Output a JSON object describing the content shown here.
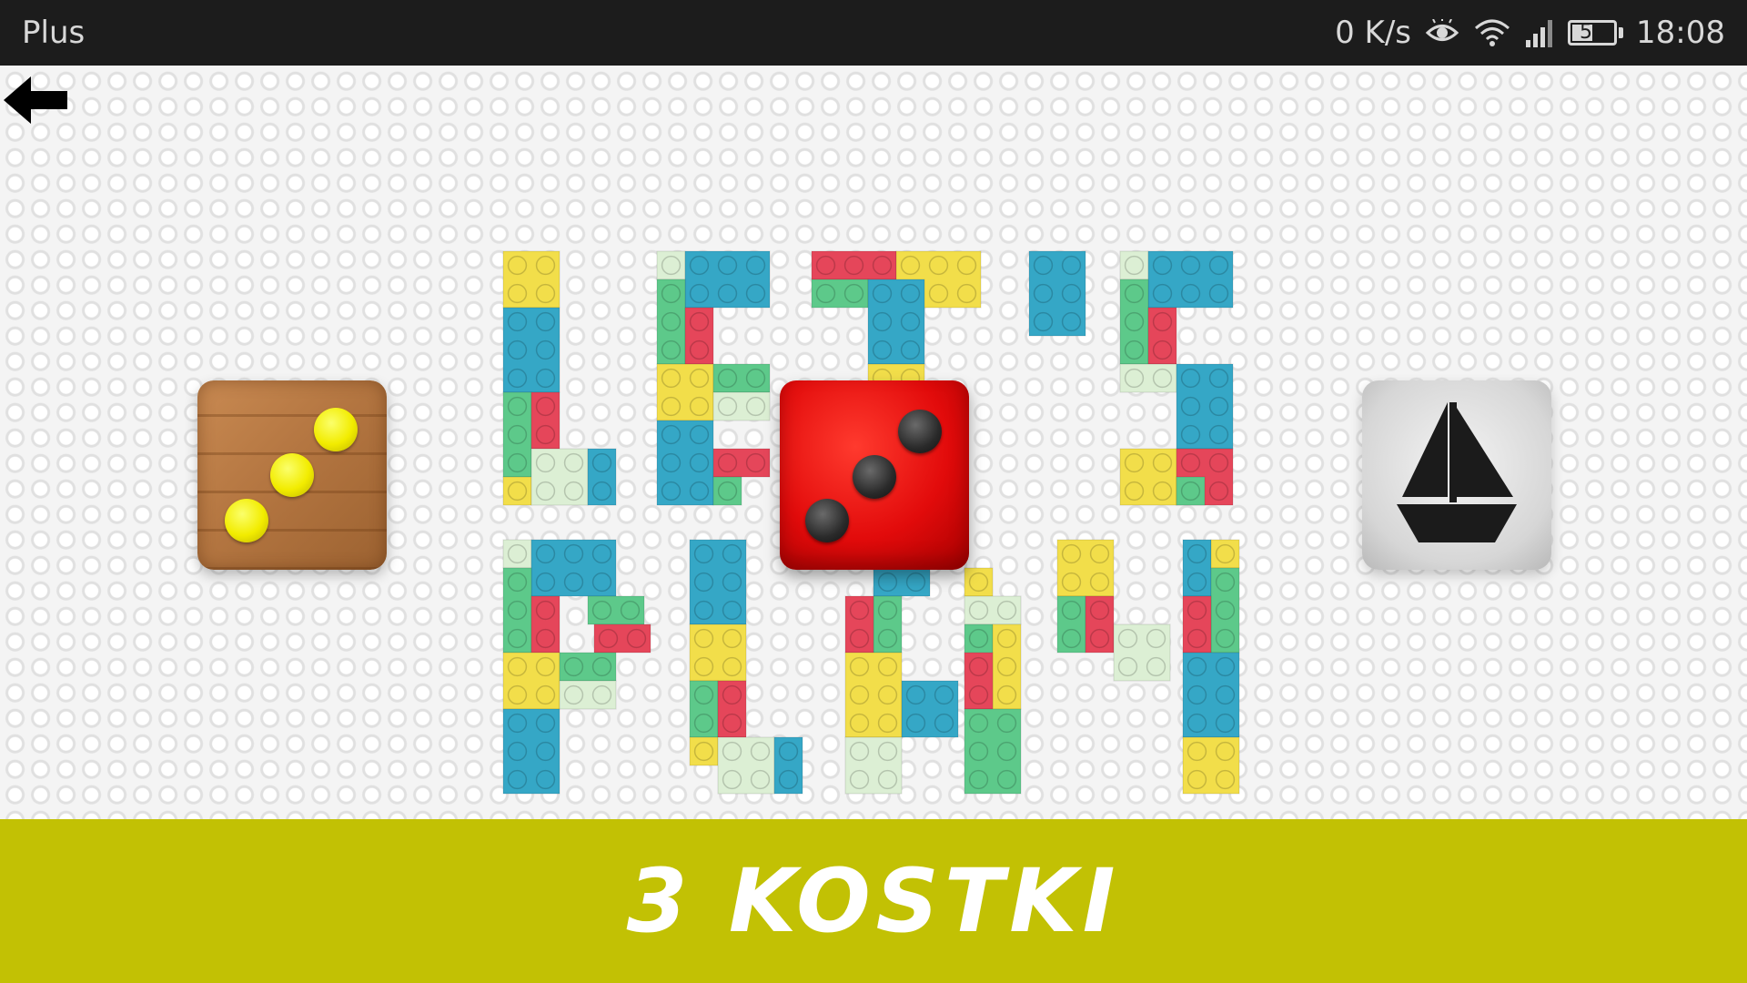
{
  "status_bar": {
    "carrier": "Plus",
    "network_speed": "0 K/s",
    "battery_level": 51,
    "battery_text": "51",
    "time": "18:08",
    "icons": [
      "eye-icon",
      "wifi-icon",
      "signal-icon",
      "battery-icon"
    ]
  },
  "board": {
    "background_icon": "lego-baseplate",
    "title_art": "LET'S PLAY",
    "title_art_colors": {
      "blue": "#35a7c6",
      "yellow": "#f2de4a",
      "red": "#e5465a",
      "green": "#5dc98a",
      "pale": "#dcefd4"
    }
  },
  "dice": {
    "wood_die_pips": 3,
    "wood_die_pip_color": "#f2ec00",
    "red_die_pips": 3,
    "red_die_color": "#e20b0b"
  },
  "banner": {
    "title": "3 KOSTKI",
    "color": "#c2c104"
  }
}
